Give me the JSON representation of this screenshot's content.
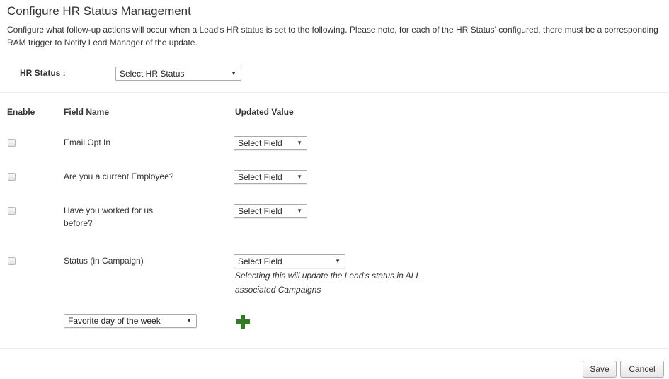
{
  "header": {
    "title": "Configure HR Status Management",
    "description": "Configure what follow-up actions will occur when a Lead's HR status is set to the following. Please note, for each of the HR Status' configured, there must be a corresponding RAM trigger to Notify Lead Manager of the update."
  },
  "hr_status": {
    "label": "HR Status :",
    "selected": "Select HR Status",
    "caret_icon": "caret-down-icon"
  },
  "table": {
    "columns": [
      "Enable",
      "Field Name",
      "Updated Value"
    ],
    "rows": [
      {
        "field_name": "Email Opt In",
        "value": "Select Field",
        "enabled": false
      },
      {
        "field_name": "Are you a current Employee?",
        "value": "Select Field",
        "enabled": false
      },
      {
        "field_name_lines": [
          "Have you worked for us",
          "before?"
        ],
        "value": "Select Field",
        "enabled": false
      },
      {
        "field_name": "Status (in Campaign)",
        "value": "Select Field",
        "enabled": false
      }
    ],
    "status_note_lines": [
      "Selecting this will update the Lead's status in ALL",
      "associated Campaigns"
    ],
    "add_field_select": "Favorite day of the week",
    "add_icon": "plus-icon",
    "add_icon_color": "#2e7d1e"
  },
  "footer": {
    "save_label": "Save",
    "cancel_label": "Cancel"
  }
}
